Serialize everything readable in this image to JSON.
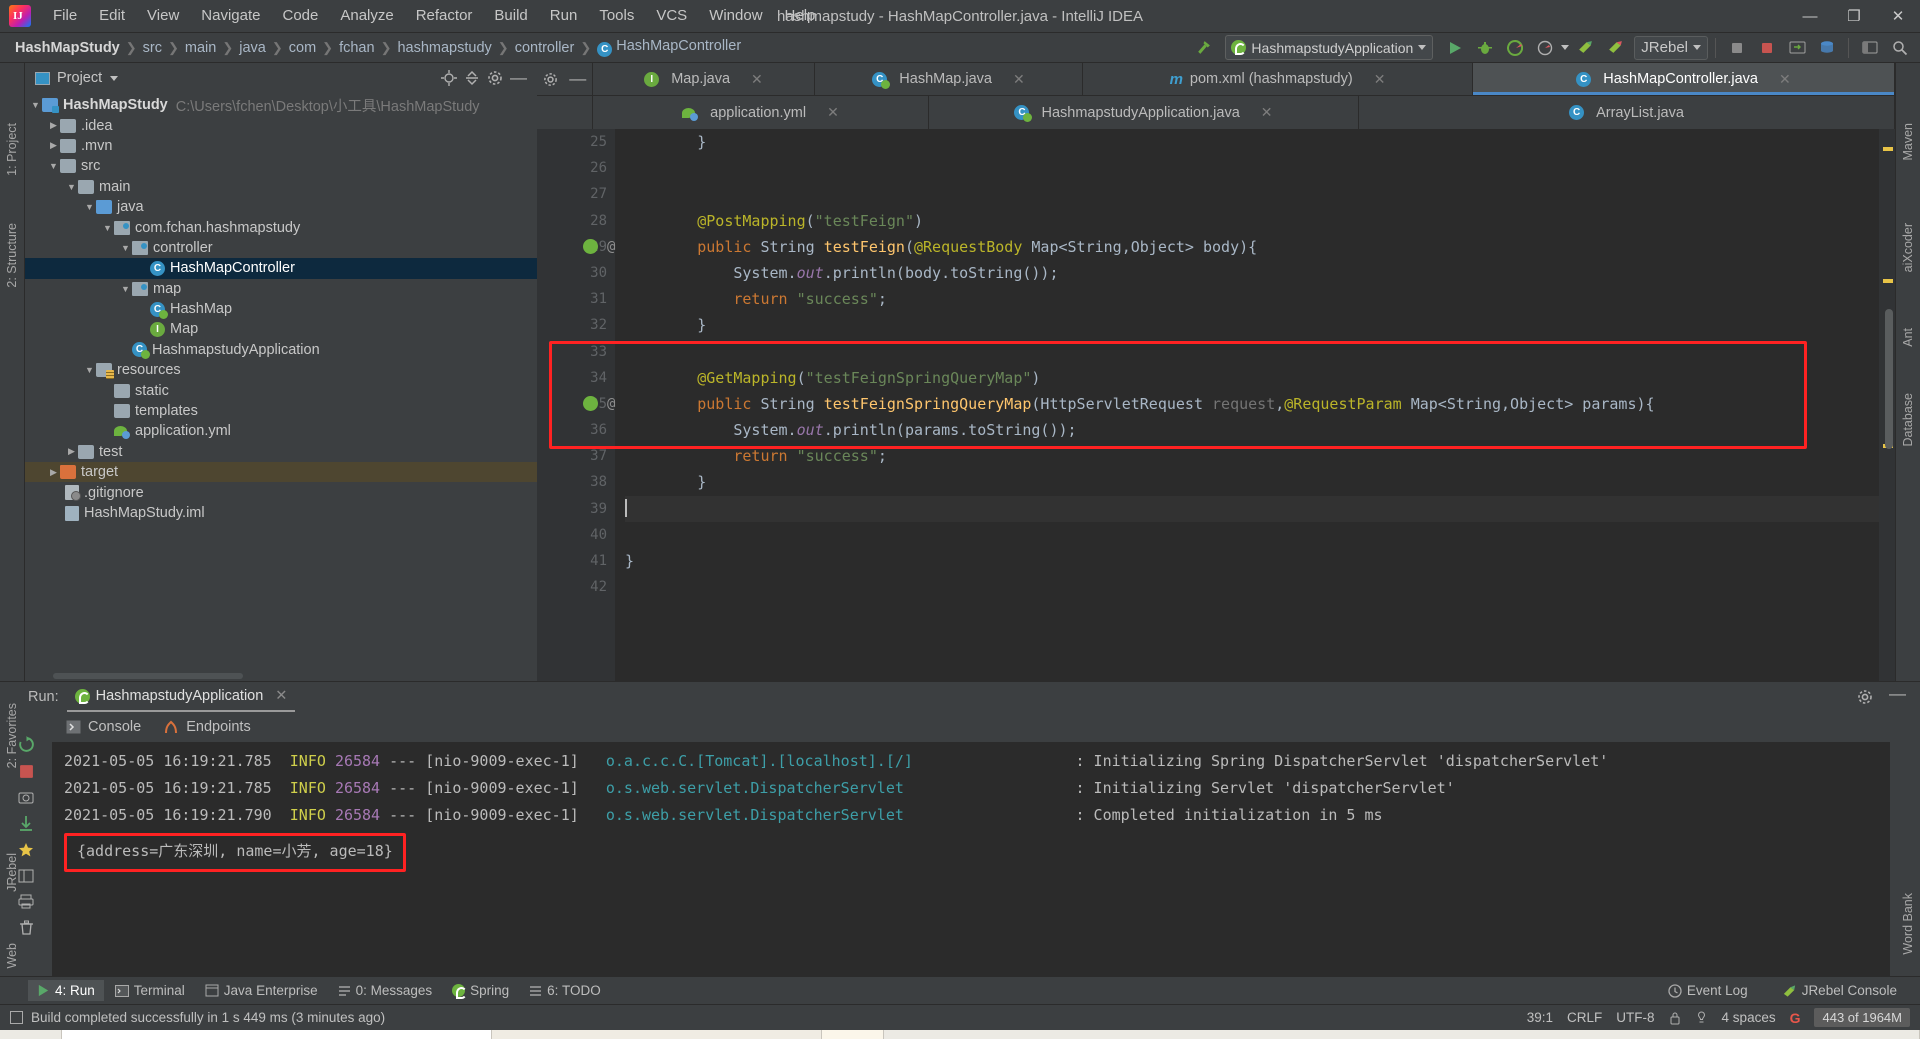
{
  "window": {
    "title": "hashmapstudy - HashMapController.java - IntelliJ IDEA",
    "minimize": "—",
    "maximize": "❐",
    "close": "✕"
  },
  "menubar": [
    {
      "label": "File"
    },
    {
      "label": "Edit"
    },
    {
      "label": "View"
    },
    {
      "label": "Navigate"
    },
    {
      "label": "Code"
    },
    {
      "label": "Analyze"
    },
    {
      "label": "Refactor"
    },
    {
      "label": "Build"
    },
    {
      "label": "Run"
    },
    {
      "label": "Tools"
    },
    {
      "label": "VCS"
    },
    {
      "label": "Window"
    },
    {
      "label": "Help"
    }
  ],
  "breadcrumb": [
    {
      "label": "HashMapStudy"
    },
    {
      "label": "src"
    },
    {
      "label": "main"
    },
    {
      "label": "java"
    },
    {
      "label": "com"
    },
    {
      "label": "fchan"
    },
    {
      "label": "hashmapstudy"
    },
    {
      "label": "controller"
    },
    {
      "label": "HashMapController"
    }
  ],
  "toolbar": {
    "run_config": "HashmapstudyApplication",
    "jrebel": "JRebel"
  },
  "project_panel": {
    "title": "Project",
    "tree": [
      {
        "label": "HashMapStudy",
        "path": "C:\\Users\\fchen\\Desktop\\小工具\\HashMapStudy",
        "depth": 0,
        "arrow": "▼",
        "icon": "module",
        "bold": true
      },
      {
        "label": ".idea",
        "depth": 1,
        "arrow": "▶",
        "icon": "folder"
      },
      {
        "label": ".mvn",
        "depth": 1,
        "arrow": "▶",
        "icon": "folder"
      },
      {
        "label": "src",
        "depth": 1,
        "arrow": "▼",
        "icon": "folder"
      },
      {
        "label": "main",
        "depth": 2,
        "arrow": "▼",
        "icon": "folder"
      },
      {
        "label": "java",
        "depth": 3,
        "arrow": "▼",
        "icon": "folder-src"
      },
      {
        "label": "com.fchan.hashmapstudy",
        "depth": 4,
        "arrow": "▼",
        "icon": "package"
      },
      {
        "label": "controller",
        "depth": 5,
        "arrow": "▼",
        "icon": "package"
      },
      {
        "label": "HashMapController",
        "depth": 6,
        "arrow": "",
        "icon": "class",
        "selected": true
      },
      {
        "label": "map",
        "depth": 5,
        "arrow": "▼",
        "icon": "package"
      },
      {
        "label": "HashMap",
        "depth": 6,
        "arrow": "",
        "icon": "class-spring"
      },
      {
        "label": "Map",
        "depth": 6,
        "arrow": "",
        "icon": "interface"
      },
      {
        "label": "HashmapstudyApplication",
        "depth": 5,
        "arrow": "",
        "icon": "class-spring"
      },
      {
        "label": "resources",
        "depth": 3,
        "arrow": "▼",
        "icon": "folder-res"
      },
      {
        "label": "static",
        "depth": 4,
        "arrow": "",
        "icon": "folder"
      },
      {
        "label": "templates",
        "depth": 4,
        "arrow": "",
        "icon": "folder"
      },
      {
        "label": "application.yml",
        "depth": 4,
        "arrow": "",
        "icon": "yml"
      },
      {
        "label": "test",
        "depth": 2,
        "arrow": "▶",
        "icon": "folder"
      },
      {
        "label": "target",
        "depth": 1,
        "arrow": "▶",
        "icon": "folder-orange",
        "highlight": true
      },
      {
        "label": ".gitignore",
        "depth": 1,
        "arrow": "",
        "icon": "file-git"
      },
      {
        "label": "HashMapStudy.iml",
        "depth": 1,
        "arrow": "",
        "icon": "file-iml"
      }
    ]
  },
  "editor_tabs_row1": [
    {
      "label": "Map.java",
      "icon": "interface",
      "close": "✕",
      "active": false
    },
    {
      "label": "HashMap.java",
      "icon": "class-spring",
      "close": "✕",
      "active": false
    },
    {
      "label": "pom.xml (hashmapstudy)",
      "icon": "maven",
      "close": "✕",
      "active": false
    },
    {
      "label": "HashMapController.java",
      "icon": "class",
      "close": "✕",
      "active": true
    }
  ],
  "editor_tabs_row2": [
    {
      "label": "application.yml",
      "icon": "yml",
      "close": "✕",
      "active": false
    },
    {
      "label": "HashmapstudyApplication.java",
      "icon": "class-spring",
      "close": "✕",
      "active": false
    },
    {
      "label": "ArrayList.java",
      "icon": "class",
      "close": "",
      "active": false
    }
  ],
  "code": {
    "first_line_number": 25,
    "lines": [
      {
        "n": 25,
        "segments": [
          {
            "t": "        }",
            "c": "blk"
          }
        ]
      },
      {
        "n": 26,
        "segments": []
      },
      {
        "n": 27,
        "segments": []
      },
      {
        "n": 28,
        "segments": [
          {
            "t": "        ",
            "c": "blk"
          },
          {
            "t": "@PostMapping",
            "c": "ann"
          },
          {
            "t": "(",
            "c": "blk"
          },
          {
            "t": "\"testFeign\"",
            "c": "str"
          },
          {
            "t": ")",
            "c": "blk"
          }
        ]
      },
      {
        "n": 29,
        "segments": [
          {
            "t": "        ",
            "c": "blk"
          },
          {
            "t": "public",
            "c": "kw"
          },
          {
            "t": " String ",
            "c": "blk"
          },
          {
            "t": "testFeign",
            "c": "mth"
          },
          {
            "t": "(",
            "c": "blk"
          },
          {
            "t": "@RequestBody",
            "c": "ann"
          },
          {
            "t": " Map<String,Object> body){",
            "c": "blk"
          }
        ]
      },
      {
        "n": 30,
        "segments": [
          {
            "t": "            System.",
            "c": "blk"
          },
          {
            "t": "out",
            "c": "fld"
          },
          {
            "t": ".println(body.toString());",
            "c": "blk"
          }
        ]
      },
      {
        "n": 31,
        "segments": [
          {
            "t": "            ",
            "c": "blk"
          },
          {
            "t": "return",
            "c": "kw"
          },
          {
            "t": " ",
            "c": "blk"
          },
          {
            "t": "\"success\"",
            "c": "str"
          },
          {
            "t": ";",
            "c": "blk"
          }
        ]
      },
      {
        "n": 32,
        "segments": [
          {
            "t": "        }",
            "c": "blk"
          }
        ]
      },
      {
        "n": 33,
        "segments": []
      },
      {
        "n": 34,
        "segments": [
          {
            "t": "        ",
            "c": "blk"
          },
          {
            "t": "@GetMapping",
            "c": "ann"
          },
          {
            "t": "(",
            "c": "blk"
          },
          {
            "t": "\"testFeignSpringQueryMap\"",
            "c": "str"
          },
          {
            "t": ")",
            "c": "blk"
          }
        ]
      },
      {
        "n": 35,
        "segments": [
          {
            "t": "        ",
            "c": "blk"
          },
          {
            "t": "public",
            "c": "kw"
          },
          {
            "t": " String ",
            "c": "blk"
          },
          {
            "t": "testFeignSpringQueryMap",
            "c": "mth"
          },
          {
            "t": "(HttpServletRequest ",
            "c": "blk"
          },
          {
            "t": "request",
            "c": "gray"
          },
          {
            "t": ",",
            "c": "blk"
          },
          {
            "t": "@RequestParam",
            "c": "ann"
          },
          {
            "t": " Map<String,Object> params){",
            "c": "blk"
          }
        ]
      },
      {
        "n": 36,
        "segments": [
          {
            "t": "            System.",
            "c": "blk"
          },
          {
            "t": "out",
            "c": "fld"
          },
          {
            "t": ".println(params.toString());",
            "c": "blk"
          }
        ]
      },
      {
        "n": 37,
        "segments": [
          {
            "t": "            ",
            "c": "blk"
          },
          {
            "t": "return",
            "c": "kw"
          },
          {
            "t": " ",
            "c": "blk"
          },
          {
            "t": "\"success\"",
            "c": "str"
          },
          {
            "t": ";",
            "c": "blk"
          }
        ]
      },
      {
        "n": 38,
        "segments": [
          {
            "t": "        }",
            "c": "blk"
          }
        ]
      },
      {
        "n": 39,
        "segments": [],
        "caret": true
      },
      {
        "n": 40,
        "segments": []
      },
      {
        "n": 41,
        "segments": [
          {
            "t": "}",
            "c": "blk"
          }
        ]
      },
      {
        "n": 42,
        "segments": []
      }
    ]
  },
  "run_panel": {
    "label": "Run:",
    "config_name": "HashmapstudyApplication",
    "close": "✕",
    "tabs": [
      {
        "label": "Console",
        "icon": "console-icon"
      },
      {
        "label": "Endpoints",
        "icon": "endpoints-icon"
      }
    ],
    "console_lines": [
      {
        "ts": "2021-05-05 16:19:21.785",
        "level": "INFO",
        "pid": "26584",
        "dash": "---",
        "thread": "[nio-9009-exec-1]",
        "logger": "o.a.c.c.C.[Tomcat].[localhost].[/]",
        "msg": ": Initializing Spring DispatcherServlet 'dispatcherServlet'"
      },
      {
        "ts": "2021-05-05 16:19:21.785",
        "level": "INFO",
        "pid": "26584",
        "dash": "---",
        "thread": "[nio-9009-exec-1]",
        "logger": "o.s.web.servlet.DispatcherServlet",
        "msg": ": Initializing Servlet 'dispatcherServlet'"
      },
      {
        "ts": "2021-05-05 16:19:21.790",
        "level": "INFO",
        "pid": "26584",
        "dash": "---",
        "thread": "[nio-9009-exec-1]",
        "logger": "o.s.web.servlet.DispatcherServlet",
        "msg": ": Completed initialization in 5 ms"
      }
    ],
    "highlighted_output": "{address=广东深圳, name=小芳, age=18}"
  },
  "tool_strip": [
    {
      "label": "4: Run",
      "icon": "run-icon",
      "active": true
    },
    {
      "label": "Terminal",
      "icon": "terminal-icon",
      "active": false
    },
    {
      "label": "Java Enterprise",
      "icon": "java-enterprise-icon",
      "active": false
    },
    {
      "label": "0: Messages",
      "icon": "messages-icon",
      "active": false
    },
    {
      "label": "Spring",
      "icon": "spring-icon",
      "active": false
    },
    {
      "label": "6: TODO",
      "icon": "todo-icon",
      "active": false
    }
  ],
  "tool_strip_right": [
    {
      "label": "Event Log",
      "icon": "event-log-icon"
    },
    {
      "label": "JRebel Console",
      "icon": "jrebel-icon"
    }
  ],
  "status_bar": {
    "message": "Build completed successfully in 1 s 449 ms (3 minutes ago)",
    "caret_position": "39:1",
    "line_separator": "CRLF",
    "encoding": "UTF-8",
    "indent": "4 spaces",
    "memory": "443 of 1964M"
  },
  "left_rail": [
    {
      "label": "1: Project"
    },
    {
      "label": "2: Structure"
    },
    {
      "label": "2: Favorites"
    },
    {
      "label": "JRebel"
    },
    {
      "label": "Web"
    }
  ],
  "right_rail": [
    {
      "label": "Maven"
    },
    {
      "label": "aiXcoder"
    },
    {
      "label": "Ant"
    },
    {
      "label": "Database"
    },
    {
      "label": "Word Bank"
    }
  ]
}
